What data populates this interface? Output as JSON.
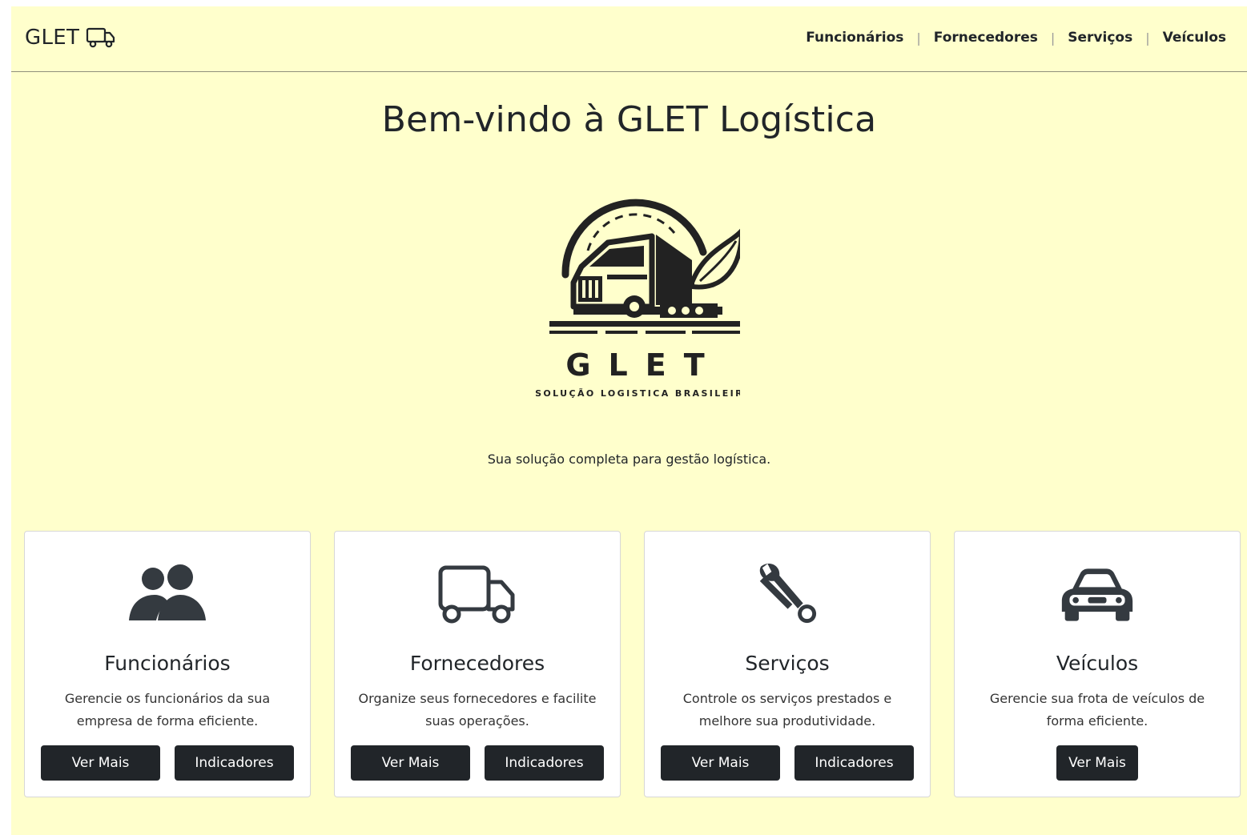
{
  "navbar": {
    "brand": "GLET",
    "brand_icon": "truck-icon",
    "links": [
      "Funcionários",
      "Fornecedores",
      "Serviços",
      "Veículos"
    ],
    "separator": "|"
  },
  "hero": {
    "title": "Bem-vindo à GLET Logística",
    "logo": {
      "name": "GLET",
      "tagline": "SOLUÇÃO LOGISTICA BRASILEIRA"
    },
    "subtitle": "Sua solução completa para gestão logística."
  },
  "cards": [
    {
      "icon": "people-icon",
      "title": "Funcionários",
      "text": "Gerencie os funcionários da sua empresa de forma eficiente.",
      "buttons": [
        "Ver Mais",
        "Indicadores"
      ]
    },
    {
      "icon": "truck-icon",
      "title": "Fornecedores",
      "text": "Organize seus fornecedores e facilite suas operações.",
      "buttons": [
        "Ver Mais",
        "Indicadores"
      ]
    },
    {
      "icon": "wrench-icon",
      "title": "Serviços",
      "text": "Controle os serviços prestados e melhore sua produtividade.",
      "buttons": [
        "Ver Mais",
        "Indicadores"
      ]
    },
    {
      "icon": "car-icon",
      "title": "Veículos",
      "text": "Gerencie sua frota de veículos de forma eficiente.",
      "buttons": [
        "Ver Mais"
      ]
    }
  ],
  "colors": {
    "page_background": "#ffffcc",
    "button_background": "#212529",
    "text": "#212529"
  }
}
